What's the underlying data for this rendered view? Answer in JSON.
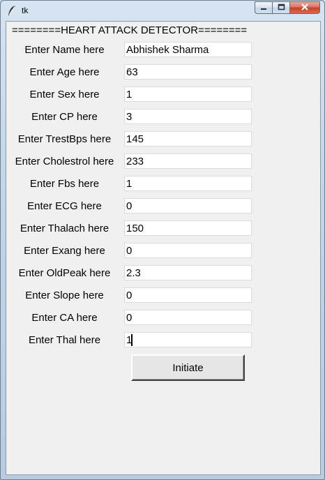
{
  "window": {
    "title": "tk",
    "icon": "feather-icon",
    "controls": [
      "minimize-icon",
      "maximize-icon",
      "close-icon"
    ]
  },
  "header": {
    "text": "========HEART ATTACK DETECTOR========"
  },
  "form": {
    "fields": [
      {
        "label": "Enter Name here",
        "value": "Abhishek Sharma"
      },
      {
        "label": "Enter Age here",
        "value": "63"
      },
      {
        "label": "Enter Sex here",
        "value": "1"
      },
      {
        "label": "Enter CP here",
        "value": "3"
      },
      {
        "label": "Enter TrestBps here",
        "value": "145"
      },
      {
        "label": "Enter Cholestrol here",
        "value": "233"
      },
      {
        "label": "Enter Fbs here",
        "value": "1"
      },
      {
        "label": "Enter ECG here",
        "value": "0"
      },
      {
        "label": "Enter Thalach here",
        "value": "150"
      },
      {
        "label": "Enter Exang here",
        "value": "0"
      },
      {
        "label": "Enter OldPeak here",
        "value": "2.3"
      },
      {
        "label": "Enter Slope here",
        "value": "0"
      },
      {
        "label": "Enter CA here",
        "value": "0"
      },
      {
        "label": "Enter Thal here",
        "value": "1"
      }
    ],
    "submit_label": "Initiate"
  }
}
